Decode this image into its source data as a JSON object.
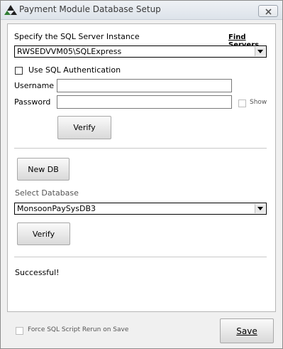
{
  "window": {
    "title": "Payment Module Database Setup"
  },
  "server": {
    "label": "Specify the SQL Server Instance",
    "find_link": "Find Servers",
    "instance": "RWSEDVVM05\\SQLExpress"
  },
  "auth": {
    "checkbox_label": "Use SQL Authentication",
    "username_label": "Username",
    "username_value": "",
    "password_label": "Password",
    "password_value": "",
    "show_label": "Show"
  },
  "buttons": {
    "verify_server": "Verify",
    "new_db": "New DB",
    "verify_db": "Verify",
    "save": "Save"
  },
  "database": {
    "label": "Select Database",
    "selected": "MonsoonPaySysDB3"
  },
  "status": {
    "message": "Successful!"
  },
  "footer": {
    "force_rerun_label": "Force SQL Script Rerun on Save"
  }
}
